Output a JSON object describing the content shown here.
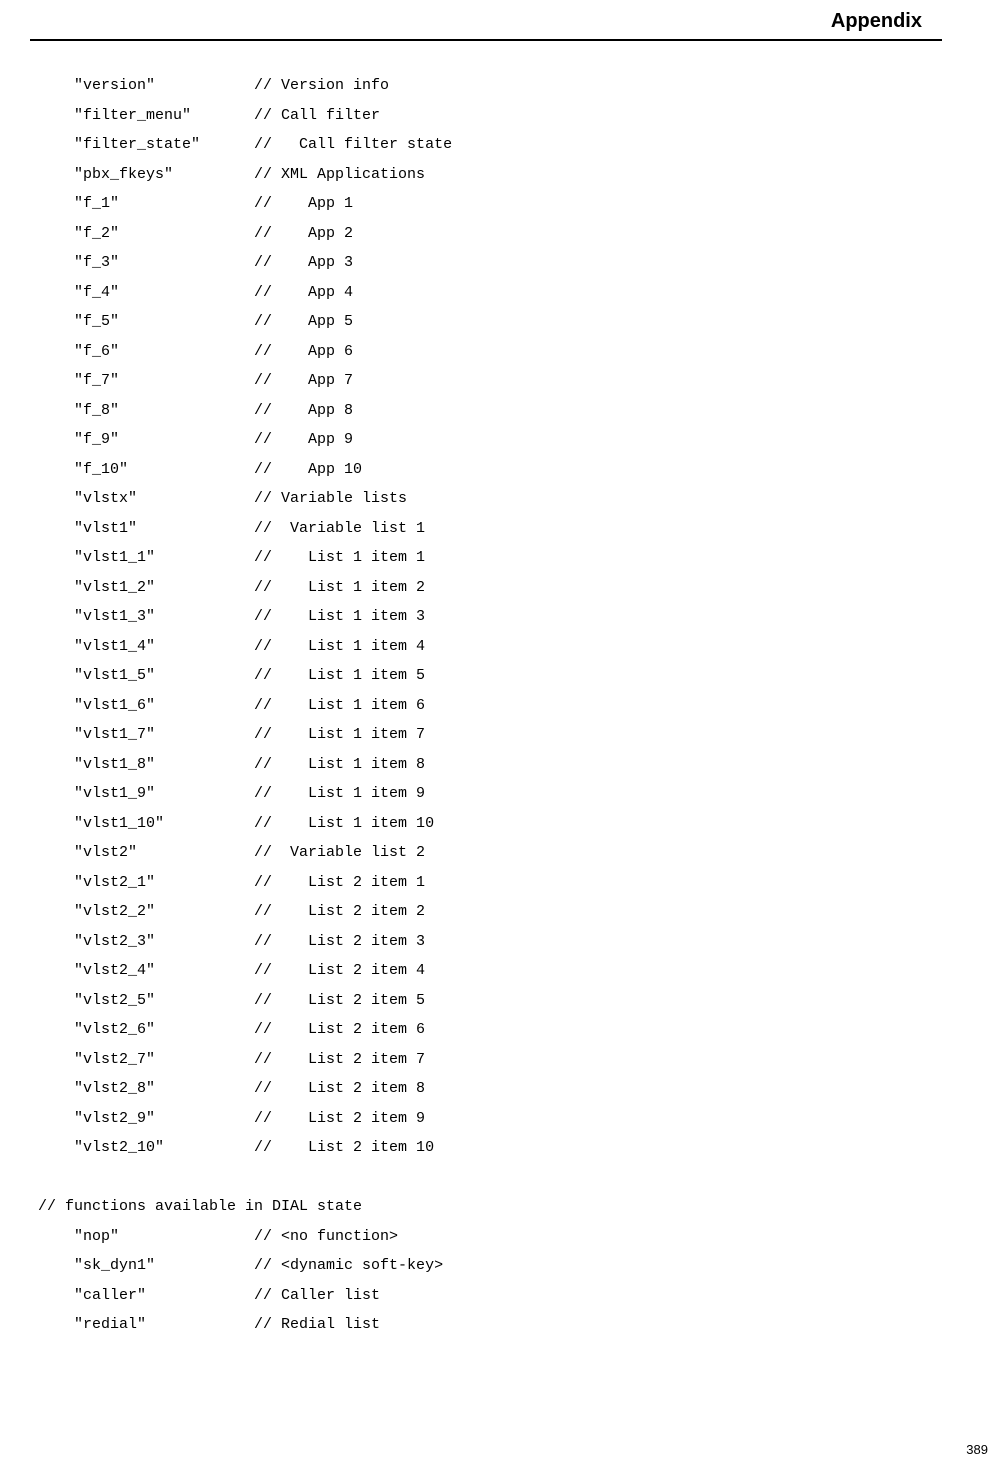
{
  "header": "Appendix",
  "pagenum": "389",
  "lines": [
    {
      "key": "\"version\"",
      "comment": "// Version info"
    },
    {
      "key": "\"filter_menu\"",
      "comment": "// Call filter"
    },
    {
      "key": "\"filter_state\"",
      "comment": "//   Call filter state"
    },
    {
      "key": "\"pbx_fkeys\"",
      "comment": "// XML Applications"
    },
    {
      "key": "\"f_1\"",
      "comment": "//    App 1"
    },
    {
      "key": "\"f_2\"",
      "comment": "//    App 2"
    },
    {
      "key": "\"f_3\"",
      "comment": "//    App 3"
    },
    {
      "key": "\"f_4\"",
      "comment": "//    App 4"
    },
    {
      "key": "\"f_5\"",
      "comment": "//    App 5"
    },
    {
      "key": "\"f_6\"",
      "comment": "//    App 6"
    },
    {
      "key": "\"f_7\"",
      "comment": "//    App 7"
    },
    {
      "key": "\"f_8\"",
      "comment": "//    App 8"
    },
    {
      "key": "\"f_9\"",
      "comment": "//    App 9"
    },
    {
      "key": "\"f_10\"",
      "comment": "//    App 10"
    },
    {
      "key": "\"vlstx\"",
      "comment": "// Variable lists"
    },
    {
      "key": "\"vlst1\"",
      "comment": "//  Variable list 1"
    },
    {
      "key": "\"vlst1_1\"",
      "comment": "//    List 1 item 1"
    },
    {
      "key": "\"vlst1_2\"",
      "comment": "//    List 1 item 2"
    },
    {
      "key": "\"vlst1_3\"",
      "comment": "//    List 1 item 3"
    },
    {
      "key": "\"vlst1_4\"",
      "comment": "//    List 1 item 4"
    },
    {
      "key": "\"vlst1_5\"",
      "comment": "//    List 1 item 5"
    },
    {
      "key": "\"vlst1_6\"",
      "comment": "//    List 1 item 6"
    },
    {
      "key": "\"vlst1_7\"",
      "comment": "//    List 1 item 7"
    },
    {
      "key": "\"vlst1_8\"",
      "comment": "//    List 1 item 8"
    },
    {
      "key": "\"vlst1_9\"",
      "comment": "//    List 1 item 9"
    },
    {
      "key": "\"vlst1_10\"",
      "comment": "//    List 1 item 10"
    },
    {
      "key": "\"vlst2\"",
      "comment": "//  Variable list 2"
    },
    {
      "key": "\"vlst2_1\"",
      "comment": "//    List 2 item 1"
    },
    {
      "key": "\"vlst2_2\"",
      "comment": "//    List 2 item 2"
    },
    {
      "key": "\"vlst2_3\"",
      "comment": "//    List 2 item 3"
    },
    {
      "key": "\"vlst2_4\"",
      "comment": "//    List 2 item 4"
    },
    {
      "key": "\"vlst2_5\"",
      "comment": "//    List 2 item 5"
    },
    {
      "key": "\"vlst2_6\"",
      "comment": "//    List 2 item 6"
    },
    {
      "key": "\"vlst2_7\"",
      "comment": "//    List 2 item 7"
    },
    {
      "key": "\"vlst2_8\"",
      "comment": "//    List 2 item 8"
    },
    {
      "key": "\"vlst2_9\"",
      "comment": "//    List 2 item 9"
    },
    {
      "key": "\"vlst2_10\"",
      "comment": "//    List 2 item 10"
    }
  ],
  "section_label": "// functions available in DIAL state",
  "lines2": [
    {
      "key": "\"nop\"",
      "comment": "// <no function>"
    },
    {
      "key": "\"sk_dyn1\"",
      "comment": "// <dynamic soft-key>"
    },
    {
      "key": "\"caller\"",
      "comment": "// Caller list"
    },
    {
      "key": "\"redial\"",
      "comment": "// Redial list"
    }
  ]
}
